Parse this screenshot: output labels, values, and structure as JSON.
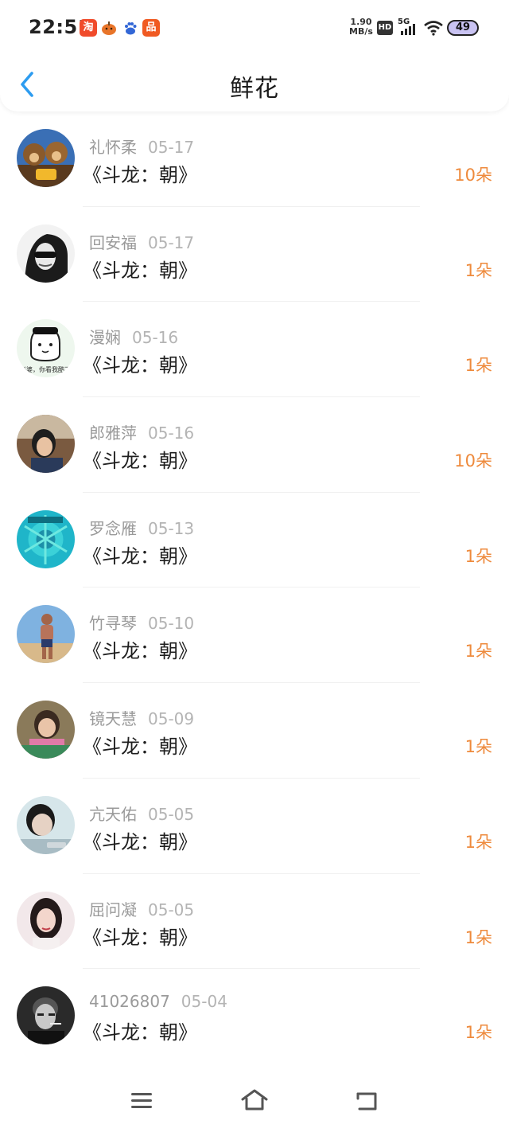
{
  "status_bar": {
    "time": "22:51",
    "net_speed_value": "1.90",
    "net_speed_unit": "MB/s",
    "hd_label": "HD",
    "network_label": "5G",
    "battery_level": "49",
    "app_icons": [
      {
        "name": "taobao-app-icon",
        "glyph": "淘",
        "color": "#f04b2b"
      },
      {
        "name": "pumpkin-app-icon",
        "glyph": "●",
        "color": "#e8752a"
      },
      {
        "name": "baidu-app-icon",
        "glyph": "✿",
        "color": "#3367d6"
      },
      {
        "name": "pinduoduo-app-icon",
        "glyph": "品",
        "color": "#f05a22"
      }
    ]
  },
  "header": {
    "title": "鲜花"
  },
  "colors": {
    "accent_orange": "#ee8a3c",
    "back_blue": "#2d9cf0",
    "name_gray": "#9a9a9a"
  },
  "items": [
    {
      "name": "礼怀柔",
      "date": "05-17",
      "book": "《斗龙：朝》",
      "count": "10朵"
    },
    {
      "name": "回安福",
      "date": "05-17",
      "book": "《斗龙：朝》",
      "count": "1朵"
    },
    {
      "name": "漫娴",
      "date": "05-16",
      "book": "《斗龙：朝》",
      "count": "1朵",
      "avatar_caption": "老婆，你看我酷不"
    },
    {
      "name": "郎雅萍",
      "date": "05-16",
      "book": "《斗龙：朝》",
      "count": "10朵"
    },
    {
      "name": "罗念雁",
      "date": "05-13",
      "book": "《斗龙：朝》",
      "count": "1朵"
    },
    {
      "name": "竹寻琴",
      "date": "05-10",
      "book": "《斗龙：朝》",
      "count": "1朵"
    },
    {
      "name": "镜天慧",
      "date": "05-09",
      "book": "《斗龙：朝》",
      "count": "1朵"
    },
    {
      "name": "亢天佑",
      "date": "05-05",
      "book": "《斗龙：朝》",
      "count": "1朵"
    },
    {
      "name": "屈问凝",
      "date": "05-05",
      "book": "《斗龙：朝》",
      "count": "1朵"
    },
    {
      "name": "41026807",
      "date": "05-04",
      "book": "《斗龙：朝》",
      "count": "1朵"
    }
  ]
}
